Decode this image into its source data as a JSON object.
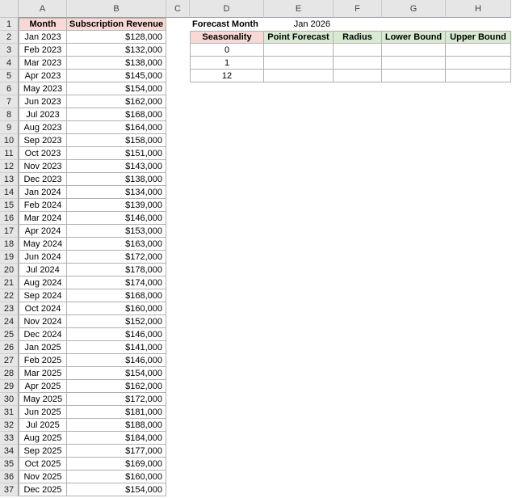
{
  "columns": [
    "A",
    "B",
    "C",
    "D",
    "E",
    "F",
    "G",
    "H"
  ],
  "rows": [
    "1",
    "2",
    "3",
    "4",
    "5",
    "6",
    "7",
    "8",
    "9",
    "10",
    "11",
    "12",
    "13",
    "14",
    "15",
    "16",
    "17",
    "18",
    "19",
    "20",
    "21",
    "22",
    "23",
    "24",
    "25",
    "26",
    "27",
    "28",
    "29",
    "30",
    "31",
    "32",
    "33",
    "34",
    "35",
    "36",
    "37"
  ],
  "table": {
    "month_header": "Month",
    "revenue_header": "Subscription Revenue",
    "months": [
      "Jan 2023",
      "Feb 2023",
      "Mar 2023",
      "Apr 2023",
      "May 2023",
      "Jun 2023",
      "Jul 2023",
      "Aug 2023",
      "Sep 2023",
      "Oct 2023",
      "Nov 2023",
      "Dec 2023",
      "Jan 2024",
      "Feb 2024",
      "Mar 2024",
      "Apr 2024",
      "May 2024",
      "Jun 2024",
      "Jul 2024",
      "Aug 2024",
      "Sep 2024",
      "Oct 2024",
      "Nov 2024",
      "Dec 2024",
      "Jan 2025",
      "Feb 2025",
      "Mar 2025",
      "Apr 2025",
      "May 2025",
      "Jun 2025",
      "Jul 2025",
      "Aug 2025",
      "Sep 2025",
      "Oct 2025",
      "Nov 2025",
      "Dec 2025"
    ],
    "revenues": [
      "$128,000",
      "$132,000",
      "$138,000",
      "$145,000",
      "$154,000",
      "$162,000",
      "$168,000",
      "$164,000",
      "$158,000",
      "$151,000",
      "$143,000",
      "$138,000",
      "$134,000",
      "$139,000",
      "$146,000",
      "$153,000",
      "$163,000",
      "$172,000",
      "$178,000",
      "$174,000",
      "$168,000",
      "$160,000",
      "$152,000",
      "$146,000",
      "$141,000",
      "$146,000",
      "$154,000",
      "$162,000",
      "$172,000",
      "$181,000",
      "$188,000",
      "$184,000",
      "$177,000",
      "$169,000",
      "$160,000",
      "$154,000"
    ]
  },
  "forecast": {
    "month_label": "Forecast Month",
    "month_value": "Jan 2026",
    "headers": [
      "Seasonality",
      "Point Forecast",
      "Radius",
      "Lower Bound",
      "Upper Bound"
    ],
    "seasonality": [
      "0",
      "1",
      "12"
    ]
  },
  "colors": {
    "header_pink": "#f8d9d5",
    "header_green": "#d9ead3",
    "grid": "#b0b0b0",
    "chrome": "#e6e6e6"
  }
}
